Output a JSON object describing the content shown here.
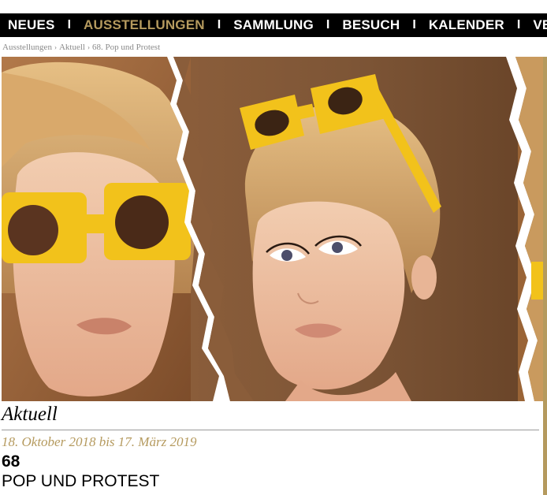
{
  "nav": {
    "items": [
      {
        "label": "NEUES",
        "active": false
      },
      {
        "label": "AUSSTELLUNGEN",
        "active": true
      },
      {
        "label": "SAMMLUNG",
        "active": false
      },
      {
        "label": "BESUCH",
        "active": false
      },
      {
        "label": "KALENDER",
        "active": false
      },
      {
        "label": "VERM",
        "active": false
      }
    ],
    "separator": "I",
    "active_color": "#b59a5e"
  },
  "breadcrumb": {
    "items": [
      "Ausstellungen",
      "Aktuell",
      "68. Pop und Protest"
    ],
    "separator": "›"
  },
  "hero": {
    "icon": "exhibition-photo"
  },
  "section": {
    "title": "Aktuell",
    "dates": "18. Oktober 2018 bis 17. März 2019",
    "number": "68",
    "name": "POP UND PROTEST"
  }
}
